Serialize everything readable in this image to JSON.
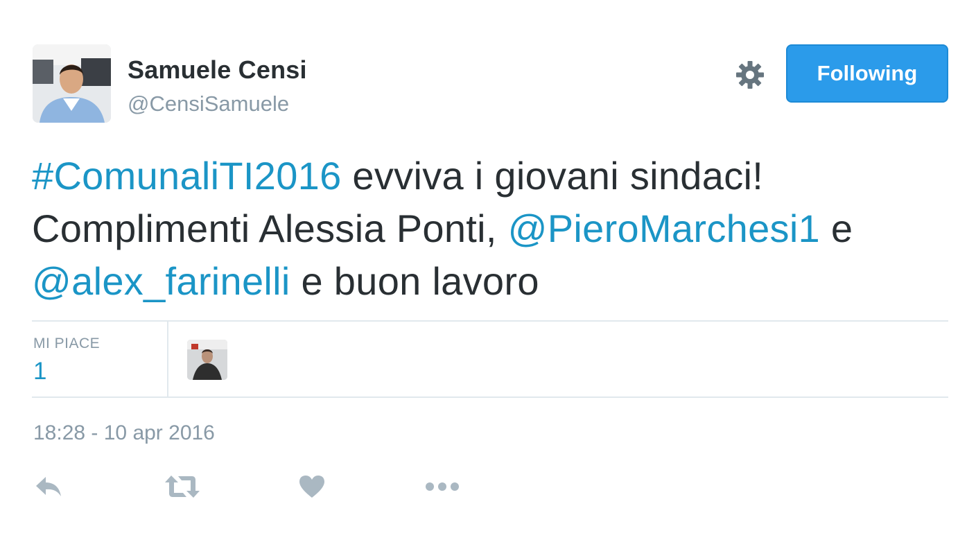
{
  "user": {
    "name": "Samuele Censi",
    "handle": "@CensiSamuele"
  },
  "header": {
    "follow_label": "Following"
  },
  "tweet": {
    "segments": [
      {
        "text": "#ComunaliTI2016",
        "type": "link"
      },
      {
        "text": " evviva i giovani sindaci!",
        "type": "text"
      },
      {
        "text": "Complimenti Alessia Ponti, ",
        "type": "text"
      },
      {
        "text": "@PieroMarchesi1",
        "type": "link"
      },
      {
        "text": " e",
        "type": "text"
      },
      {
        "text": "@alex_farinelli",
        "type": "link"
      },
      {
        "text": " e buon lavoro",
        "type": "text"
      }
    ]
  },
  "stats": {
    "likes_label": "MI PIACE",
    "likes_count": "1"
  },
  "timestamp": "18:28 - 10 apr 2016",
  "actions": {
    "reply_icon": "reply-icon",
    "retweet_icon": "retweet-icon",
    "like_icon": "heart-icon",
    "more_icon": "more-dots-icon"
  },
  "colors": {
    "accent": "#2b9bea",
    "link": "#1b95c6",
    "text": "#292f33",
    "muted": "#8899a6",
    "action_icon": "#aab8c2"
  }
}
